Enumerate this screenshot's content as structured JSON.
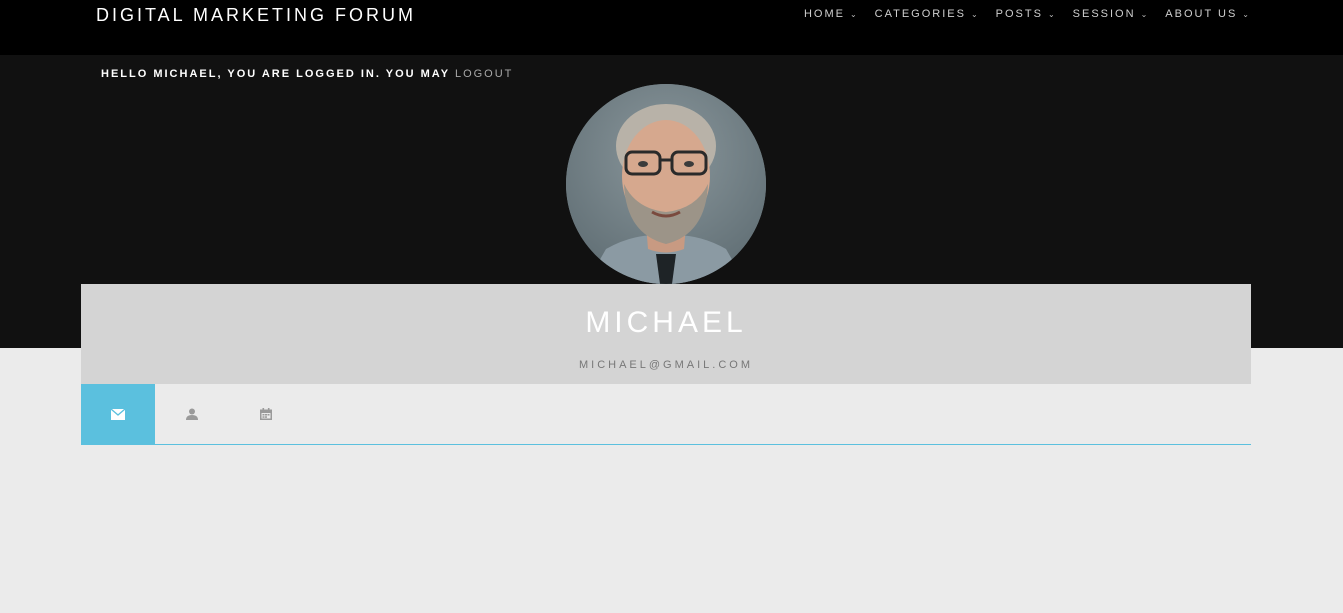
{
  "site": {
    "title": "DIGITAL MARKETING FORUM"
  },
  "nav": {
    "items": [
      {
        "label": "HOME"
      },
      {
        "label": "CATEGORIES"
      },
      {
        "label": "POSTS"
      },
      {
        "label": "SESSION"
      },
      {
        "label": "ABOUT US"
      }
    ]
  },
  "login": {
    "message": "HELLO MICHAEL, YOU ARE LOGGED IN. YOU MAY ",
    "logout_label": "LOGOUT"
  },
  "profile": {
    "name": "MICHAEL",
    "email": "MICHAEL@GMAIL.COM"
  },
  "tabs": [
    {
      "icon": "envelope-icon",
      "active": true
    },
    {
      "icon": "user-icon",
      "active": false
    },
    {
      "icon": "calendar-icon",
      "active": false
    }
  ],
  "colors": {
    "accent": "#5bc0de",
    "topbar": "#000000",
    "hero": "#111111",
    "card": "#d4d4d4",
    "page_background": "#ebebeb"
  }
}
